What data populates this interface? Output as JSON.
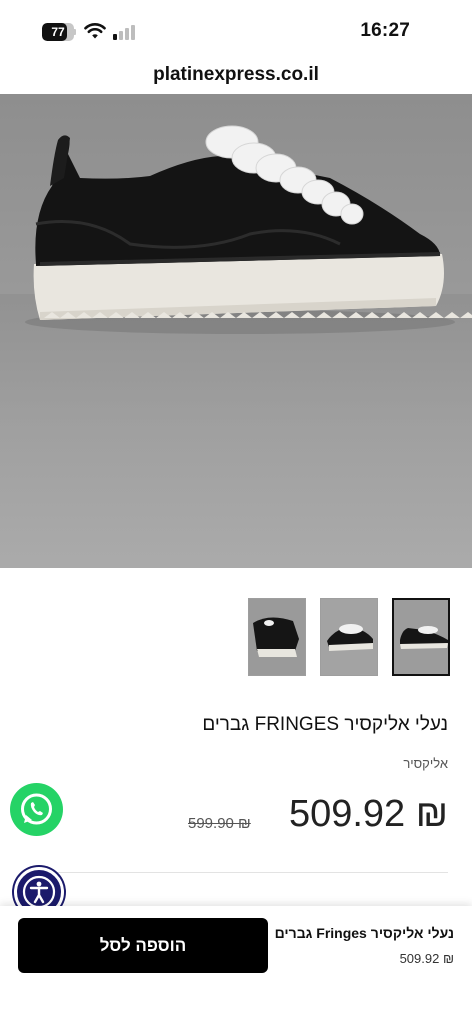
{
  "status_bar": {
    "battery_percent": "77",
    "battery_level": 0.77,
    "time": "16:27",
    "wifi_icon": "wifi-icon",
    "signal_icon": "cellular-signal-icon"
  },
  "browser": {
    "url": "platinexpress.co.il"
  },
  "product": {
    "image": "sneaker-photo",
    "thumbnails": [
      "thumbnail-rear-view",
      "thumbnail-angle-view",
      "thumbnail-side-view"
    ],
    "active_thumbnail": 2,
    "title": "נעלי אליקסיר FRINGES גברים",
    "brand": "אליקסיר",
    "price": "509.92 ₪",
    "old_price": "599.90 ₪"
  },
  "floating": {
    "whatsapp_icon": "whatsapp-icon",
    "accessibility_icon": "accessibility-icon"
  },
  "sticky_cart": {
    "add_to_cart_label": "הוספה לסל",
    "title": "נעלי אליקסיר Fringes גברים",
    "price": "509.92 ₪"
  },
  "colors": {
    "whatsapp": "#25d366",
    "accessibility": "#1b1a6b",
    "button": "#000000"
  }
}
